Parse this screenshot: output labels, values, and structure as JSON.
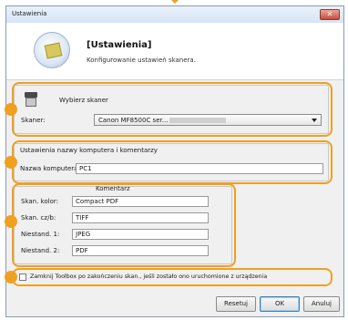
{
  "window": {
    "title": "Ustawienia",
    "close_glyph": "✕"
  },
  "header": {
    "title": "[Ustawienia]",
    "subtitle": "Konfigurowanie ustawień skanera."
  },
  "scanner_group": {
    "caption": "Wybierz skaner",
    "scanner_label": "Skaner:",
    "scanner_value": "Canon MF8500C ser..."
  },
  "computer_group": {
    "caption": "Ustawienia nazwy komputera i komentarzy",
    "name_label": "Nazwa komputera:",
    "name_value": "PC1"
  },
  "comments_group": {
    "column_header": "Komentarz",
    "rows": [
      {
        "label": "Skan. kolor:",
        "value": "Compact PDF"
      },
      {
        "label": "Skan. cz/b:",
        "value": "TIFF"
      },
      {
        "label": "Niestand. 1:",
        "value": "JPEG"
      },
      {
        "label": "Niestand. 2:",
        "value": "PDF"
      }
    ]
  },
  "close_toolbox": {
    "label": "Zamknij Toolbox po zakończeniu skan., jeśli zostało ono uruchomione z urządzenia",
    "checked": false
  },
  "buttons": {
    "reset": "Resetuj",
    "ok": "OK",
    "cancel": "Anuluj"
  },
  "colors": {
    "highlight": "#f0a020",
    "title_gradient_top": "#eaf2fb",
    "close_button": "#c94b3a"
  }
}
